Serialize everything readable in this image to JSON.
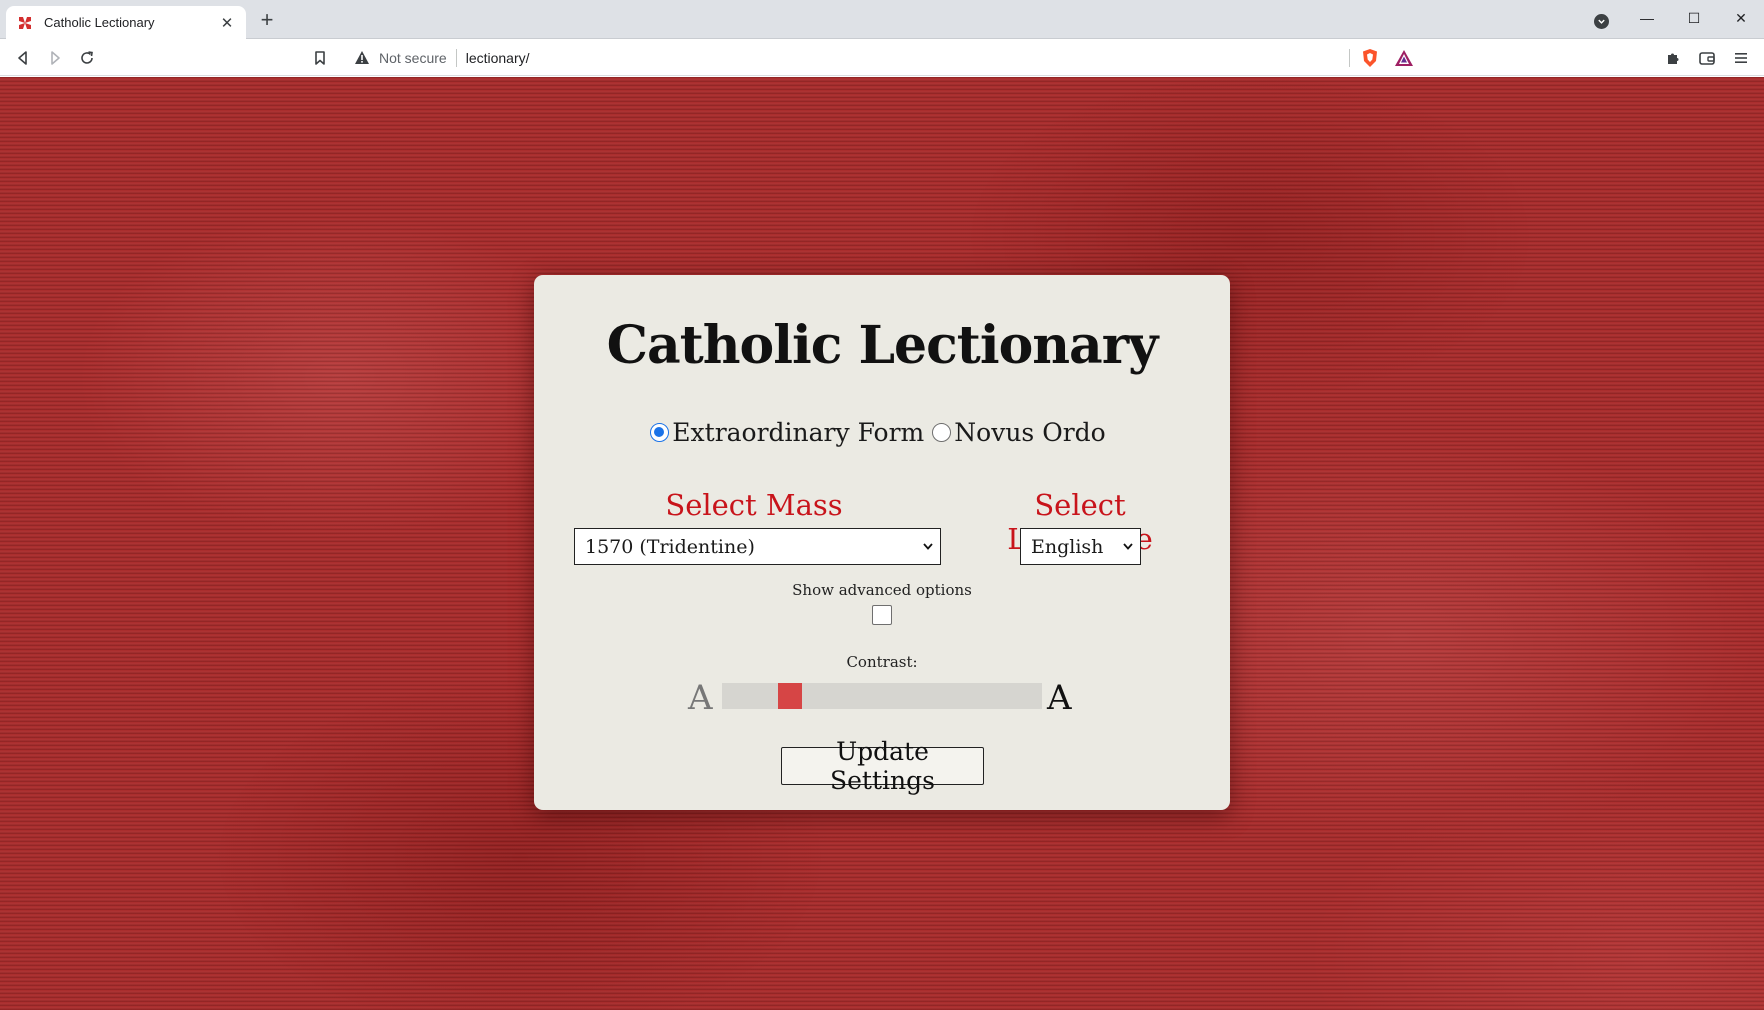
{
  "browser": {
    "tab_title": "Catholic Lectionary",
    "tab_close": "✕",
    "new_tab": "+",
    "security_label": "Not secure",
    "url": "lectionary/",
    "window_controls": [
      "—",
      "☐",
      "✕"
    ]
  },
  "page": {
    "title": "Catholic Lectionary",
    "form_options": [
      {
        "label": "Extraordinary Form",
        "checked": true
      },
      {
        "label": "Novus Ordo",
        "checked": false
      }
    ],
    "select_mass": {
      "label": "Select Mass",
      "value": "1570 (Tridentine)"
    },
    "select_language": {
      "label": "Select Language",
      "value": "English"
    },
    "advanced": {
      "label": "Show advanced options",
      "checked": false
    },
    "contrast": {
      "label": "Contrast:",
      "small_glyph": "A",
      "large_glyph": "A",
      "value_fraction": 0.19
    },
    "update_button": "Update Settings"
  },
  "colors": {
    "accent_red": "#c8141b",
    "background_red": "#a92b2b",
    "card_bg": "#ebeae3",
    "radio_blue": "#1a73e8",
    "slider_thumb": "#d64545"
  },
  "icons": [
    "favicon-cross-icon",
    "back-icon",
    "forward-icon",
    "reload-icon",
    "bookmark-icon",
    "warning-icon",
    "brave-shield-icon",
    "brave-rewards-icon",
    "extensions-icon",
    "wallet-icon",
    "menu-icon",
    "tab-search-icon"
  ]
}
